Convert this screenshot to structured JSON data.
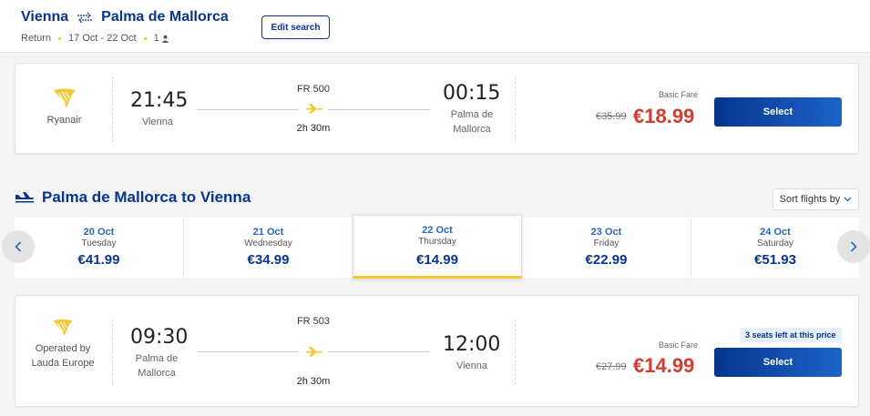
{
  "header": {
    "origin": "Vienna",
    "destination": "Palma de Mallorca",
    "trip_type": "Return",
    "dates": "17 Oct - 22 Oct",
    "passengers": "1",
    "edit_label": "Edit search"
  },
  "outbound": {
    "airline": "Ryanair",
    "dep_time": "21:45",
    "dep_city": "Vienna",
    "flight_no": "FR 500",
    "duration": "2h 30m",
    "arr_time": "00:15",
    "arr_city": "Palma de Mallorca",
    "fare_label": "Basic Fare",
    "old_price": "€35.99",
    "price": "€18.99",
    "select_label": "Select"
  },
  "return_section": {
    "title": "Palma de Mallorca to Vienna",
    "sort_label": "Sort flights by"
  },
  "date_strip": [
    {
      "date": "20 Oct",
      "weekday": "Tuesday",
      "price": "€41.99",
      "selected": false
    },
    {
      "date": "21 Oct",
      "weekday": "Wednesday",
      "price": "€34.99",
      "selected": false
    },
    {
      "date": "22 Oct",
      "weekday": "Thursday",
      "price": "€14.99",
      "selected": true
    },
    {
      "date": "23 Oct",
      "weekday": "Friday",
      "price": "€22.99",
      "selected": false
    },
    {
      "date": "24 Oct",
      "weekday": "Saturday",
      "price": "€51.93",
      "selected": false
    }
  ],
  "return_flight": {
    "airline": "Operated by Lauda Europe",
    "dep_time": "09:30",
    "dep_city": "Palma de Mallorca",
    "flight_no": "FR 503",
    "duration": "2h 30m",
    "arr_time": "12:00",
    "arr_city": "Vienna",
    "fare_label": "Basic Fare",
    "seats_badge": "3 seats left at this price",
    "old_price": "€27.99",
    "price": "€14.99",
    "select_label": "Select"
  },
  "colors": {
    "brand_blue": "#073590",
    "price_red": "#d63b2f",
    "accent_yellow": "#f1c933"
  }
}
